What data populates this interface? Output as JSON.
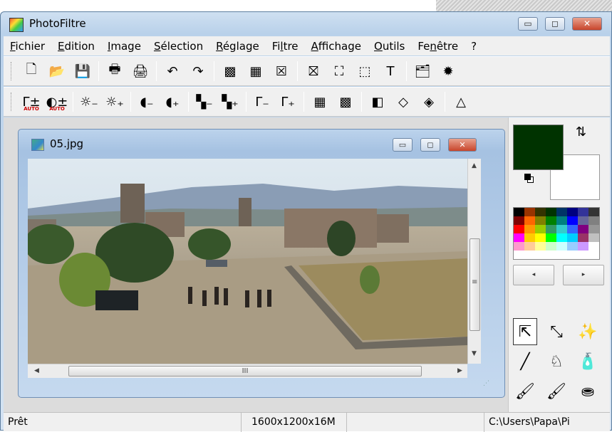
{
  "window": {
    "title": "PhotoFiltre",
    "controls": {
      "minimize": "▭",
      "maximize": "◻",
      "close": "✕"
    }
  },
  "menu": [
    {
      "label": "Fichier",
      "underline": "F"
    },
    {
      "label": "Edition",
      "underline": "E"
    },
    {
      "label": "Image",
      "underline": "I"
    },
    {
      "label": "Sélection",
      "underline": "S"
    },
    {
      "label": "Réglage",
      "underline": "R"
    },
    {
      "label": "Filtre",
      "underline": "l"
    },
    {
      "label": "Affichage",
      "underline": "A"
    },
    {
      "label": "Outils",
      "underline": "O"
    },
    {
      "label": "Fenêtre",
      "underline": "n"
    },
    {
      "label": "?",
      "underline": ""
    }
  ],
  "toolbar1": [
    {
      "icon": "new-document-icon",
      "glyph": "🗋"
    },
    {
      "icon": "open-folder-icon",
      "glyph": "📂"
    },
    {
      "icon": "save-icon",
      "glyph": "💾"
    },
    {
      "sep": true
    },
    {
      "icon": "print-icon",
      "glyph": "🖶"
    },
    {
      "icon": "scanner-icon",
      "glyph": "🖨"
    },
    {
      "sep": true
    },
    {
      "icon": "undo-icon",
      "glyph": "↶"
    },
    {
      "icon": "redo-icon",
      "glyph": "↷"
    },
    {
      "sep": true
    },
    {
      "icon": "gradient-icon",
      "glyph": "▩"
    },
    {
      "icon": "color-palette-icon",
      "glyph": "▦"
    },
    {
      "icon": "automate-icon",
      "glyph": "☒"
    },
    {
      "sep": true
    },
    {
      "icon": "transform-icon",
      "glyph": "⛝"
    },
    {
      "icon": "zoom-fit-icon",
      "glyph": "⛶"
    },
    {
      "icon": "selection-crop-icon",
      "glyph": "⬚"
    },
    {
      "icon": "text-icon",
      "glyph": "T"
    },
    {
      "sep": true
    },
    {
      "icon": "explorer-icon",
      "glyph": "🗂"
    },
    {
      "icon": "plugin-icon",
      "glyph": "✹"
    }
  ],
  "toolbar2": [
    {
      "icon": "gamma-auto-icon",
      "glyph": "Γ±",
      "sub": "AUTO"
    },
    {
      "icon": "contrast-auto-icon",
      "glyph": "◐±",
      "sub": "AUTO"
    },
    {
      "sep": true
    },
    {
      "icon": "brightness-minus-icon",
      "glyph": "☼₋"
    },
    {
      "icon": "brightness-plus-icon",
      "glyph": "☼₊"
    },
    {
      "sep": true
    },
    {
      "icon": "contrast-minus-icon",
      "glyph": "◖₋"
    },
    {
      "icon": "contrast-plus-icon",
      "glyph": "◖₊"
    },
    {
      "sep": true
    },
    {
      "icon": "saturation-minus-icon",
      "glyph": "▚₋"
    },
    {
      "icon": "saturation-plus-icon",
      "glyph": "▚₊"
    },
    {
      "sep": true
    },
    {
      "icon": "gamma-minus-icon",
      "glyph": "Γ₋"
    },
    {
      "icon": "gamma-plus-icon",
      "glyph": "Γ₊"
    },
    {
      "sep": true
    },
    {
      "icon": "mosaic-icon",
      "glyph": "▦"
    },
    {
      "icon": "texture-icon",
      "glyph": "▩"
    },
    {
      "sep": true
    },
    {
      "icon": "stamp-icon",
      "glyph": "◧"
    },
    {
      "icon": "blur-drop-icon",
      "glyph": "◇"
    },
    {
      "icon": "sharpen-drop-icon",
      "glyph": "◈"
    },
    {
      "sep": true
    },
    {
      "icon": "triangle-icon",
      "glyph": "△"
    }
  ],
  "document": {
    "title": "05.jpg",
    "scroll_grip": "III",
    "vscroll_grip": "≡"
  },
  "palette": {
    "foreground": "#003300",
    "background": "#ffffff",
    "swatches": [
      "#000000",
      "#993300",
      "#333300",
      "#003300",
      "#003366",
      "#000080",
      "#333399",
      "#333333",
      "#800000",
      "#ff6600",
      "#808000",
      "#008000",
      "#008080",
      "#0000ff",
      "#666699",
      "#808080",
      "#ff0000",
      "#ff9900",
      "#99cc00",
      "#339966",
      "#33cccc",
      "#3366ff",
      "#800080",
      "#969696",
      "#ff00ff",
      "#ffcc00",
      "#ffff00",
      "#00ff00",
      "#00ffff",
      "#00ccff",
      "#993366",
      "#c0c0c0",
      "#ff99cc",
      "#ffcc99",
      "#ffff99",
      "#ccffcc",
      "#ccffff",
      "#99ccff",
      "#cc99ff",
      "#ffffff",
      "#ffffff",
      "#ffffff",
      "#ffffff",
      "#ffffff",
      "#ffffff",
      "#ffffff",
      "#ffffff",
      "#ffffff"
    ],
    "prev_label": "◂",
    "next_label": "▸"
  },
  "tools": [
    {
      "icon": "selection-arrow-icon",
      "glyph": "⇱",
      "selected": true
    },
    {
      "icon": "color-picker-icon",
      "glyph": "⤡"
    },
    {
      "icon": "magic-wand-icon",
      "glyph": "✨"
    },
    {
      "icon": "line-icon",
      "glyph": "╱"
    },
    {
      "icon": "fill-bucket-icon",
      "glyph": "♘"
    },
    {
      "icon": "spray-icon",
      "glyph": "🧴"
    },
    {
      "icon": "brush-icon",
      "glyph": "🖌"
    },
    {
      "icon": "advanced-brush-icon",
      "glyph": "🖌"
    },
    {
      "icon": "clone-stamp-icon",
      "glyph": "⛂"
    }
  ],
  "status": {
    "ready": "Prêt",
    "dimensions": "1600x1200x16M",
    "path": "C:\\Users\\Papa\\Pi"
  }
}
